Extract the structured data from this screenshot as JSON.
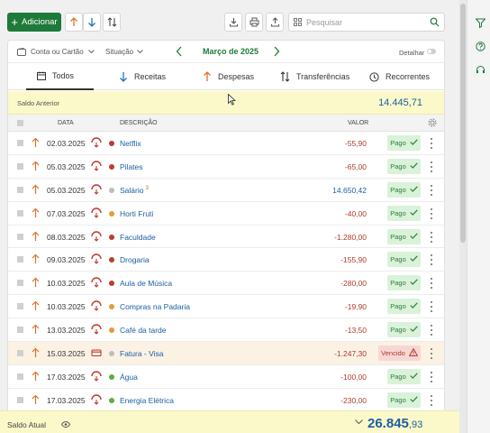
{
  "toolbar": {
    "add_label": "Adicionar",
    "search_placeholder": "Pesquisar"
  },
  "filters": {
    "account_label": "Conta ou Cartão",
    "situation_label": "Situação",
    "month_label": "Março de 2025",
    "detail_label": "Detalhar"
  },
  "tabs": [
    {
      "label": "Todos",
      "icon": "calendar-icon",
      "active": true
    },
    {
      "label": "Receitas",
      "icon": "arrow-down-icon",
      "active": false
    },
    {
      "label": "Despesas",
      "icon": "arrow-up-icon",
      "active": false
    },
    {
      "label": "Transferências",
      "icon": "swap-icon",
      "active": false
    },
    {
      "label": "Recorrentes",
      "icon": "clock-icon",
      "active": false
    }
  ],
  "saldo_anterior": {
    "label": "Saldo Anterior",
    "value": "14.445,71"
  },
  "table": {
    "headers": {
      "date": "DATA",
      "description": "DESCRIÇÃO",
      "value": "VALOR"
    },
    "rows": [
      {
        "date": "02.03.2025",
        "desc": "Netflix",
        "badge": "",
        "value": "-55,90",
        "status": "Pago",
        "dot": "#c0392b",
        "kind": "neg"
      },
      {
        "date": "05.03.2025",
        "desc": "Pilates",
        "badge": "",
        "value": "-65,00",
        "status": "Pago",
        "dot": "#c0392b",
        "kind": "neg"
      },
      {
        "date": "05.03.2025",
        "desc": "Salário",
        "badge": "3",
        "value": "14.650,42",
        "status": "Pago",
        "dot": "#bdbdbd",
        "kind": "pos"
      },
      {
        "date": "07.03.2025",
        "desc": "Horti Fruti",
        "badge": "",
        "value": "-40,00",
        "status": "Pago",
        "dot": "#e39b3a",
        "kind": "neg"
      },
      {
        "date": "08.03.2025",
        "desc": "Faculdade",
        "badge": "",
        "value": "-1.280,00",
        "status": "Pago",
        "dot": "#c0392b",
        "kind": "neg"
      },
      {
        "date": "09.03.2025",
        "desc": "Drogaria",
        "badge": "",
        "value": "-155,90",
        "status": "Pago",
        "dot": "#c0392b",
        "kind": "neg"
      },
      {
        "date": "10.03.2025",
        "desc": "Aula de Música",
        "badge": "",
        "value": "-280,00",
        "status": "Pago",
        "dot": "#c0392b",
        "kind": "neg"
      },
      {
        "date": "10.03.2025",
        "desc": "Compras na Padaria",
        "badge": "",
        "value": "-19,90",
        "status": "Pago",
        "dot": "#e39b3a",
        "kind": "neg"
      },
      {
        "date": "13.03.2025",
        "desc": "Café da tarde",
        "badge": "",
        "value": "-13,50",
        "status": "Pago",
        "dot": "#e39b3a",
        "kind": "neg"
      },
      {
        "date": "15.03.2025",
        "desc": "Fatura - Visa",
        "badge": "",
        "value": "-1.247,30",
        "status": "Vencido",
        "dot": "#bdbdbd",
        "kind": "neg",
        "overdue": true
      },
      {
        "date": "17.03.2025",
        "desc": "Água",
        "badge": "",
        "value": "-100,00",
        "status": "Pago",
        "dot": "#5aae3e",
        "kind": "neg"
      },
      {
        "date": "17.03.2025",
        "desc": "Energia Elétrica",
        "badge": "",
        "value": "-230,00",
        "status": "Pago",
        "dot": "#5aae3e",
        "kind": "neg"
      }
    ]
  },
  "footer": {
    "label": "Saldo Atual",
    "total_main": "26.845",
    "total_cents": ",93"
  },
  "colors": {
    "accent_green": "#1e7a3a",
    "blue_value": "#1b5fa3",
    "red_value": "#b03a2e",
    "highlight_yellow": "#fbf9c9"
  }
}
